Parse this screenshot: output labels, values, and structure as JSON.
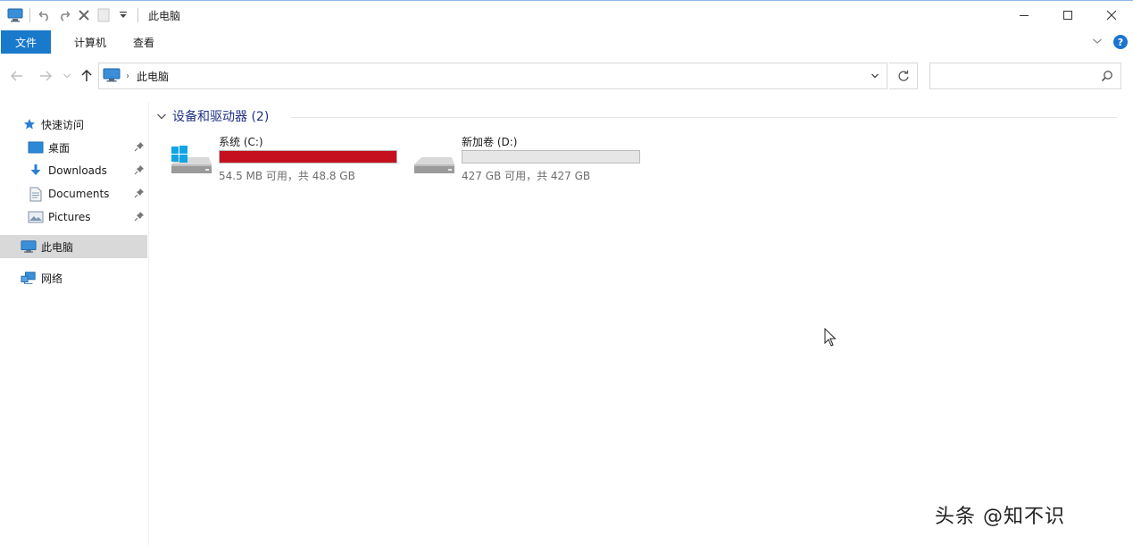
{
  "window": {
    "title": "此电脑"
  },
  "quick_access_toolbar": {
    "icons": [
      "this-pc-icon",
      "properties-icon",
      "undo-icon",
      "redo-icon",
      "delete-icon",
      "new-folder-icon",
      "customize-dropdown-icon"
    ]
  },
  "window_controls": [
    "minimize",
    "maximize",
    "close"
  ],
  "ribbon": {
    "tabs": [
      {
        "label": "文件"
      },
      {
        "label": "计算机"
      },
      {
        "label": "查看"
      }
    ]
  },
  "address": {
    "breadcrumb": "此电脑",
    "search_placeholder": "",
    "search_value": ""
  },
  "sidebar": {
    "quick_access_label": "快速访问",
    "pinned": [
      {
        "label": "桌面",
        "icon": "desktop-icon"
      },
      {
        "label": "Downloads",
        "icon": "download-icon"
      },
      {
        "label": "Documents",
        "icon": "document-icon"
      },
      {
        "label": "Pictures",
        "icon": "picture-icon"
      }
    ],
    "this_pc_label": "此电脑",
    "network_label": "网络"
  },
  "content": {
    "group_title": "设备和驱动器 (2)",
    "drives": [
      {
        "name": "系统 (C:)",
        "info": "54.5 MB 可用，共 48.8 GB",
        "used_fraction": 0.999,
        "bar_color": "#c4101f",
        "icon": "windows-drive-icon"
      },
      {
        "name": "新加卷 (D:)",
        "info": "427 GB 可用，共 427 GB",
        "used_fraction": 0.0,
        "bar_color": "#26a0da",
        "icon": "hard-drive-icon"
      }
    ]
  },
  "colors": {
    "accent": "#1979ca",
    "selected": "#d9d9d9",
    "full_drive": "#c4101f"
  },
  "watermark": "头条 @知不识"
}
